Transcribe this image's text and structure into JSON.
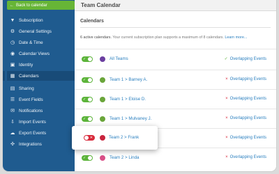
{
  "sidebar": {
    "back_label": "Back to calendar",
    "items": [
      {
        "label": "Subscription",
        "icon": "funnel-icon"
      },
      {
        "label": "General Settings",
        "icon": "gear-icon"
      },
      {
        "label": "Date & Time",
        "icon": "clock-icon"
      },
      {
        "label": "Calendar Views",
        "icon": "eye-icon"
      },
      {
        "label": "Identity",
        "icon": "id-card-icon"
      },
      {
        "label": "Calendars",
        "icon": "calendar-icon",
        "active": true
      },
      {
        "label": "Sharing",
        "icon": "share-icon"
      },
      {
        "label": "Event Fields",
        "icon": "list-icon"
      },
      {
        "label": "Notifications",
        "icon": "chat-icon"
      },
      {
        "label": "Import Events",
        "icon": "import-icon"
      },
      {
        "label": "Export Events",
        "icon": "cloud-icon"
      },
      {
        "label": "Integrations",
        "icon": "puzzle-icon"
      }
    ]
  },
  "header": {
    "title": "Team Calendar"
  },
  "section": {
    "title": "Calendars",
    "info_lead": "6 active calendars.",
    "info_text": " Your current subscription plan supports a maximum of 8 calendars.",
    "info_link": "Learn more..."
  },
  "calendars": [
    {
      "name": "All Teams",
      "color": "#6b3fa0",
      "enabled": true,
      "status": "Overlapping Events",
      "status_mark": "✓",
      "mark_color": "#5cb43a"
    },
    {
      "name": "Team 1 > Barney A.",
      "color": "#6aa53a",
      "enabled": true,
      "status": "Overlapping Events",
      "status_mark": "×",
      "mark_color": "#d82a3b"
    },
    {
      "name": "Team 1 > Eloise D.",
      "color": "#6aa53a",
      "enabled": true,
      "status": "Overlapping Events",
      "status_mark": "×",
      "mark_color": "#d82a3b"
    },
    {
      "name": "Team 1 > Mulvaney J.",
      "color": "#6aa53a",
      "enabled": true,
      "status": "Overlapping Events",
      "status_mark": "×",
      "mark_color": "#d82a3b"
    },
    {
      "name": "Team 2 > Frank",
      "color": "#c8243d",
      "enabled": false,
      "status": "Overlapping Events",
      "status_mark": "×",
      "mark_color": "#d82a3b"
    },
    {
      "name": "Team 2 > Linda",
      "color": "#d94f87",
      "enabled": true,
      "status": "Overlapping Events",
      "status_mark": "×",
      "mark_color": "#d82a3b"
    }
  ],
  "colors": {
    "sidebar": "#1f5b8f",
    "accent_green": "#67b536",
    "link": "#2a7fbf",
    "off_red": "#d82a3b"
  }
}
